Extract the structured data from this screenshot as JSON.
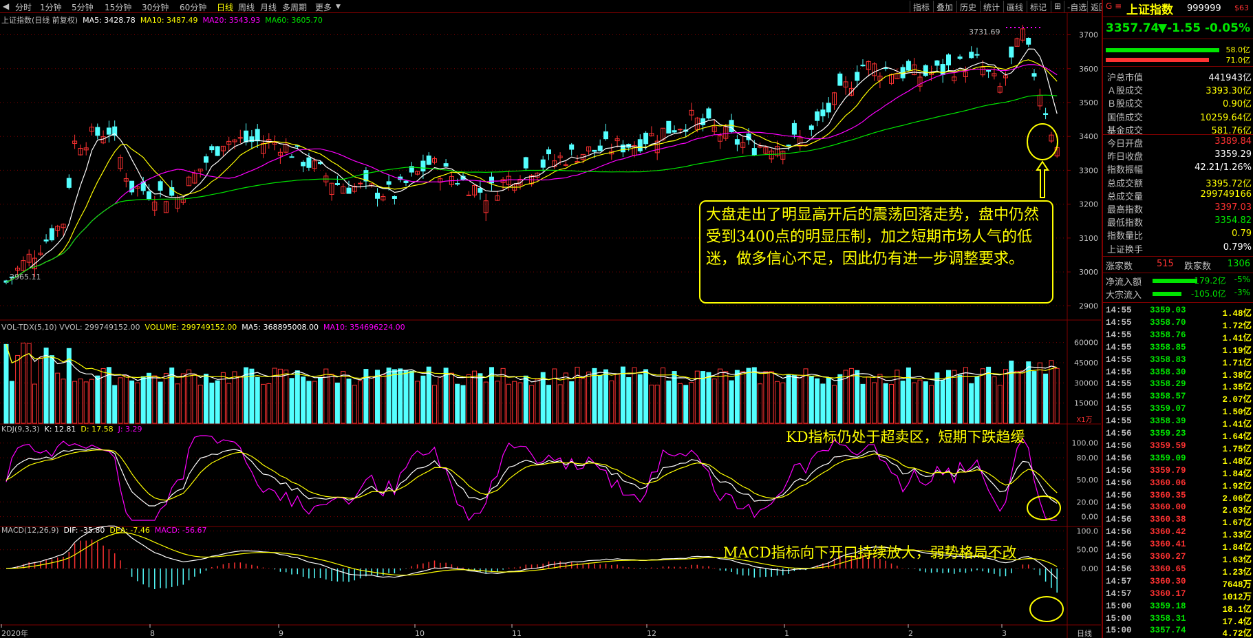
{
  "topbar": {
    "periods": [
      "分时",
      "1分钟",
      "5分钟",
      "15分钟",
      "30分钟",
      "60分钟",
      "日线",
      "周线",
      "月线",
      "多周期",
      "更多"
    ],
    "active": "日线",
    "right_buttons": [
      "指标",
      "叠加",
      "历史",
      "统计",
      "画线",
      "标记"
    ]
  },
  "main_legend": {
    "title": "上证指数(日线 前复权)",
    "ma5": "MA5: 3428.78",
    "ma10": "MA10: 3487.49",
    "ma20": "MA20: 3543.93",
    "ma60": "MA60: 3605.70"
  },
  "vol_legend": {
    "title": "VOL-TDX(5,10) VVOL: 299749152.00",
    "volume": "VOLUME: 299749152.00",
    "ma5": "MA5: 368895008.00",
    "ma10": "MA10: 354696224.00"
  },
  "kdj_legend": {
    "title": "KDJ(9,3,3)",
    "k": "K: 12.81",
    "d": "D: 17.58",
    "j": "J: 3.29"
  },
  "macd_legend": {
    "title": "MACD(12,26,9)",
    "dif": "DIF: -35.80",
    "dea": "DEA: -7.46",
    "macd": "MACD: -56.67"
  },
  "price_marks": {
    "high": "3731.69",
    "low": "2965.11"
  },
  "axis": {
    "price": [
      "3700",
      "3600",
      "3500",
      "3400",
      "3300",
      "3200",
      "3100",
      "3000",
      "2900"
    ],
    "volume": [
      "60000",
      "45000",
      "30000",
      "15000"
    ],
    "volume_unit": "X1万",
    "kdj": [
      "100.00",
      "80.00",
      "50.00",
      "20.00",
      "0.00"
    ],
    "macd": [
      "100.0",
      "50.00",
      "0.00"
    ],
    "months": [
      "2020年",
      "8",
      "9",
      "10",
      "11",
      "12",
      "1",
      "2",
      "3"
    ],
    "corner": "日线"
  },
  "annotations": {
    "main": "大盘走出了明显高开后的震荡回落走势，盘中仍然受到3400点的明显压制，加之短期市场人气的低迷，做多信心不足，因此仍有进一步调整要求。",
    "kdj": "KD指标仍处于超卖区，短期下跌趋缓",
    "macd": "MACD指标向下开口持续放大，弱势格局不改"
  },
  "sidebar": {
    "title": "上证指数",
    "code": "999999",
    "tag": "$63",
    "price": "3357.74",
    "change": "▼-1.55",
    "pct": "-0.05%",
    "bar1": "58.0亿",
    "bar2": "71.0亿",
    "stats": [
      [
        "沪总市值",
        "441943亿",
        "#ffffff"
      ],
      [
        "Ａ股成交",
        "3393.30亿",
        "#ffff00"
      ],
      [
        "Ｂ股成交",
        "0.90亿",
        "#ffff00"
      ],
      [
        "国债成交",
        "10259.64亿",
        "#ffff00"
      ],
      [
        "基金成交",
        "581.76亿",
        "#ffff00"
      ],
      [
        "今日开盘",
        "3389.84",
        "#ff3232"
      ],
      [
        "昨日收盘",
        "3359.29",
        "#ffffff"
      ],
      [
        "指数振幅",
        "42.21/1.26%",
        "#ffffff"
      ],
      [
        "总成交额",
        "3395.72亿",
        "#ffff00"
      ],
      [
        "总成交量",
        "299749166",
        "#ffff00"
      ],
      [
        "最高指数",
        "3397.03",
        "#ff3232"
      ],
      [
        "最低指数",
        "3354.82",
        "#00e600"
      ],
      [
        "指数量比",
        "0.79",
        "#ffff00"
      ],
      [
        "上证换手",
        "0.79%",
        "#ffffff"
      ]
    ],
    "up_label": "涨家数",
    "up": "515",
    "down_label": "跌家数",
    "down": "1306",
    "flow1_label": "净流入额",
    "flow1": "-179.2亿",
    "flow1_pct": "-5%",
    "flow2_label": "大宗流入",
    "flow2": "-105.0亿",
    "flow2_pct": "-3%",
    "ticks": [
      [
        "14:55",
        "3359.03",
        "1.48亿",
        "#00e600"
      ],
      [
        "14:55",
        "3358.70",
        "1.72亿",
        "#00e600"
      ],
      [
        "14:55",
        "3358.76",
        "1.41亿",
        "#00e600"
      ],
      [
        "14:55",
        "3358.85",
        "1.19亿",
        "#00e600"
      ],
      [
        "14:55",
        "3358.83",
        "1.71亿",
        "#00e600"
      ],
      [
        "14:55",
        "3358.30",
        "1.38亿",
        "#00e600"
      ],
      [
        "14:55",
        "3358.29",
        "1.35亿",
        "#00e600"
      ],
      [
        "14:55",
        "3358.57",
        "2.07亿",
        "#00e600"
      ],
      [
        "14:55",
        "3359.07",
        "1.50亿",
        "#00e600"
      ],
      [
        "14:55",
        "3358.39",
        "1.41亿",
        "#00e600"
      ],
      [
        "14:56",
        "3359.23",
        "1.64亿",
        "#00e600"
      ],
      [
        "14:56",
        "3359.59",
        "1.75亿",
        "#ff3232"
      ],
      [
        "14:56",
        "3359.09",
        "1.48亿",
        "#00e600"
      ],
      [
        "14:56",
        "3359.79",
        "1.84亿",
        "#ff3232"
      ],
      [
        "14:56",
        "3360.06",
        "1.92亿",
        "#ff3232"
      ],
      [
        "14:56",
        "3360.35",
        "2.06亿",
        "#ff3232"
      ],
      [
        "14:56",
        "3360.00",
        "2.03亿",
        "#ff3232"
      ],
      [
        "14:56",
        "3360.38",
        "1.67亿",
        "#ff3232"
      ],
      [
        "14:56",
        "3360.42",
        "1.33亿",
        "#ff3232"
      ],
      [
        "14:56",
        "3360.41",
        "1.84亿",
        "#ff3232"
      ],
      [
        "14:56",
        "3360.27",
        "1.63亿",
        "#ff3232"
      ],
      [
        "14:56",
        "3360.65",
        "1.23亿",
        "#ff3232"
      ],
      [
        "14:57",
        "3360.30",
        "7648万",
        "#ff3232"
      ],
      [
        "14:57",
        "3360.17",
        "1012万",
        "#ff3232"
      ],
      [
        "15:00",
        "3359.18",
        "18.1亿",
        "#00e600"
      ],
      [
        "15:00",
        "3358.31",
        "17.4亿",
        "#00e600"
      ],
      [
        "15:00",
        "3357.74",
        "4.72亿",
        "#00e600"
      ]
    ]
  },
  "colors": {
    "up": "#ff3232",
    "down": "#54ffff",
    "ma5": "#ffffff",
    "ma10": "#ffff00",
    "ma20": "#ff00ff",
    "ma60": "#00e600",
    "grid": "#800000"
  }
}
